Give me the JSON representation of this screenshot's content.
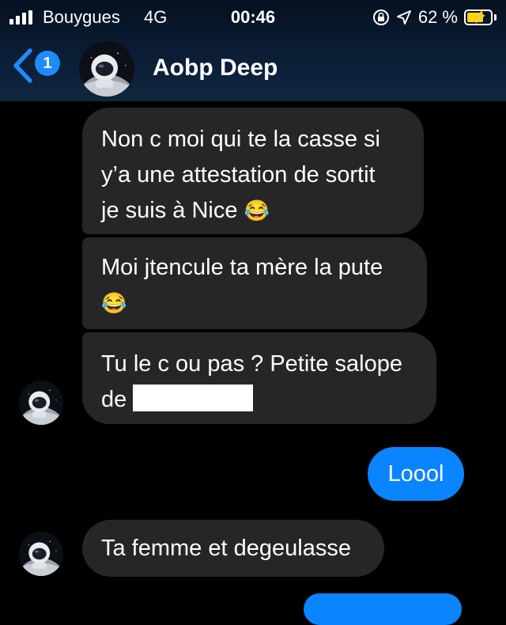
{
  "status": {
    "carrier": "Bouygues",
    "network": "4G",
    "time": "00:46",
    "battery": "62 %"
  },
  "header": {
    "back_count": "1",
    "name": "Aobp Deep"
  },
  "messages": {
    "m1": {
      "l1": "Non c moi qui te la casse si",
      "l2": "y’a une attestation de sortit",
      "l3": "je suis à Nice",
      "emoji": "😂"
    },
    "m2": {
      "l1": "Moi jtencule ta mère la pute",
      "emoji": "😂"
    },
    "m3": {
      "l1": "Tu le c ou pas ? Petite salope",
      "l2": "de"
    },
    "m4": {
      "text": "Loool"
    },
    "m5": {
      "text": "Ta femme et degeulasse"
    }
  },
  "colors": {
    "accent": "#0a84ff",
    "bubble_in": "#262628",
    "battery": "#ffd60a"
  }
}
